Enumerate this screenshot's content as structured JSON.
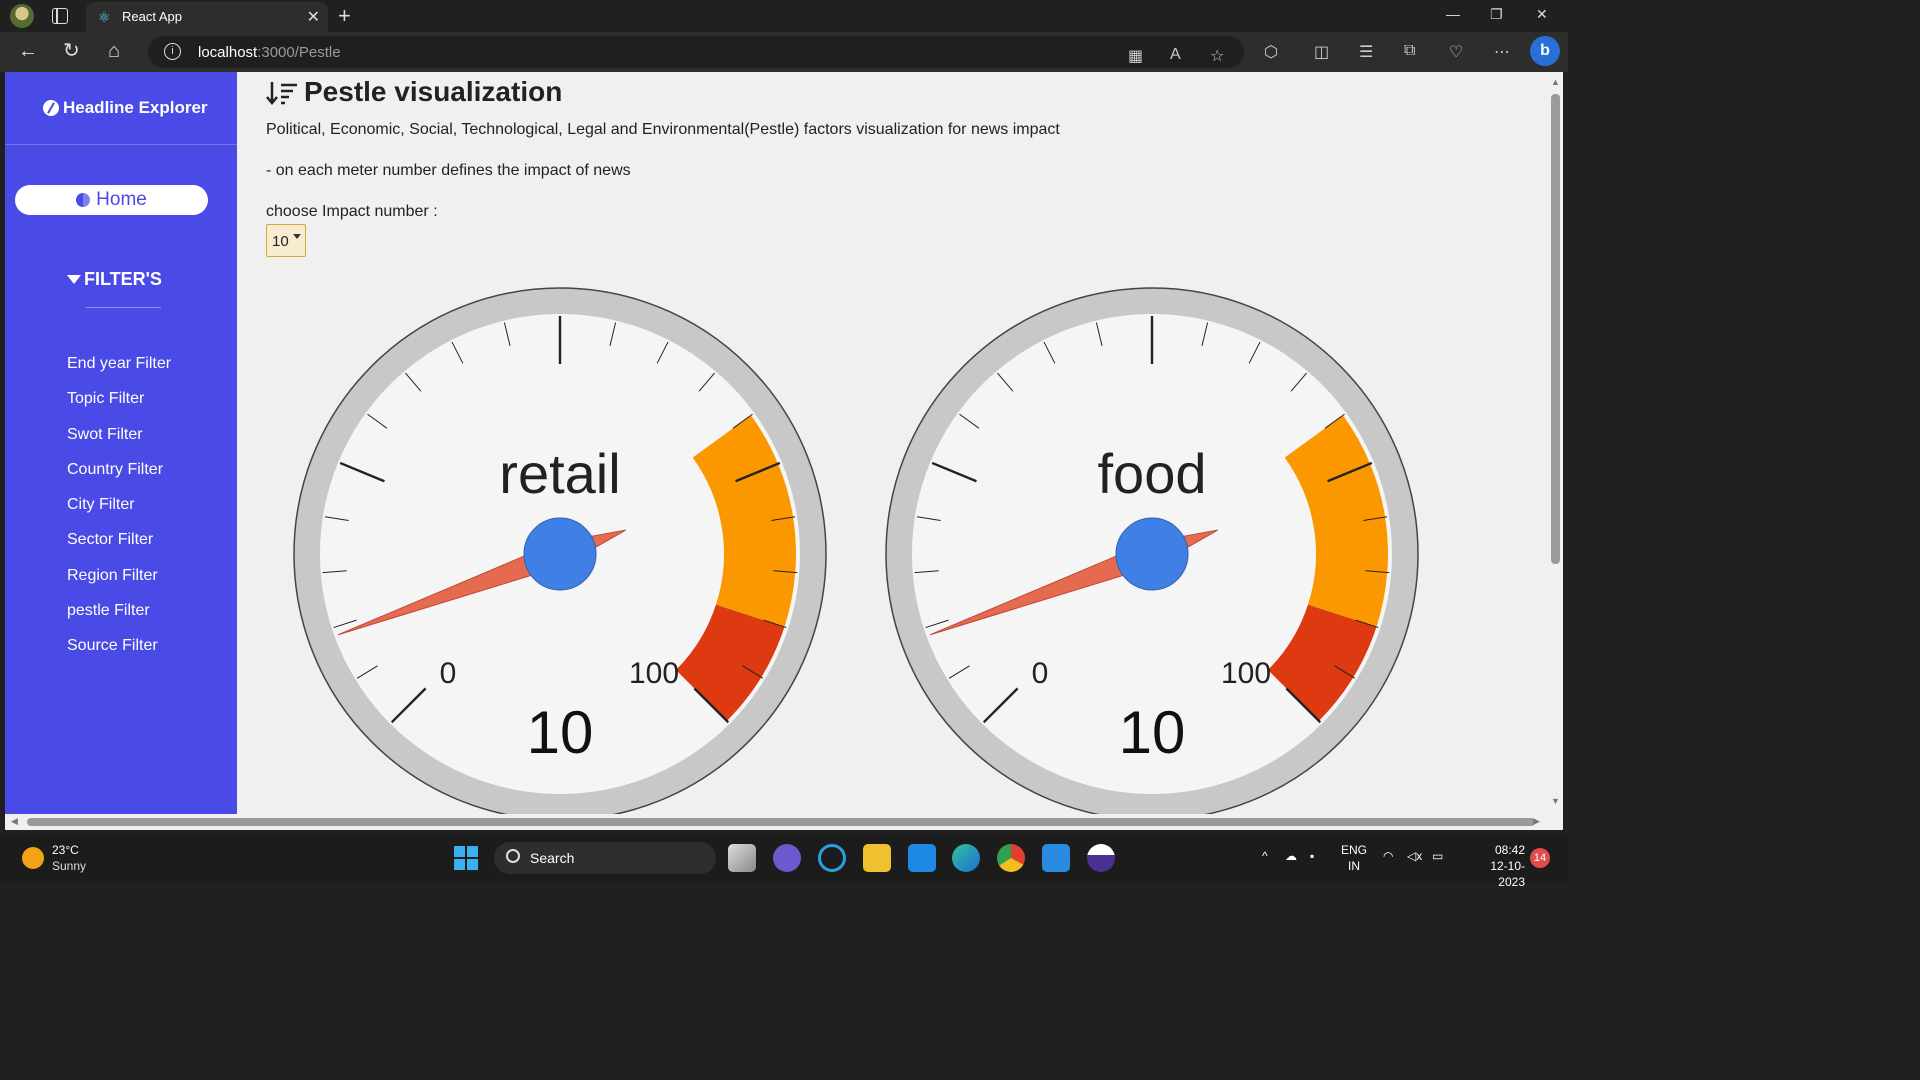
{
  "browser": {
    "tab_title": "React App",
    "url_host": "localhost",
    "url_rest": ":3000/Pestle"
  },
  "sidebar": {
    "brand": "Headline Explorer",
    "home_label": "Home",
    "filters_title": "FILTER'S",
    "items": [
      {
        "label": "End year Filter"
      },
      {
        "label": "Topic Filter"
      },
      {
        "label": "Swot Filter"
      },
      {
        "label": "Country Filter"
      },
      {
        "label": "City Filter"
      },
      {
        "label": "Sector Filter"
      },
      {
        "label": "Region Filter"
      },
      {
        "label": "pestle Filter"
      },
      {
        "label": "Source Filter"
      }
    ]
  },
  "main": {
    "title": "Pestle visualization",
    "description": "Political, Economic, Social, Technological, Legal and Environmental(Pestle) factors visualization for news impact",
    "note": "- on each meter number defines the impact of news",
    "select_label": "choose Impact number :",
    "select_value": "10"
  },
  "gauges": [
    {
      "label": "retail",
      "value": "10",
      "min_label": "0",
      "max_label": "100",
      "value_number": 10
    },
    {
      "label": "food",
      "value": "10",
      "min_label": "0",
      "max_label": "100",
      "value_number": 10
    }
  ],
  "colors": {
    "sidebar_bg": "#4a4ae6",
    "needle": "#e46a50",
    "hub": "#3f7fe6",
    "band_orange": "#fb9800",
    "band_red": "#dd3a12",
    "rim": "#c8c8c8"
  },
  "taskbar": {
    "temperature": "23°C",
    "weather": "Sunny",
    "search_label": "Search",
    "lang_line1": "ENG",
    "lang_line2": "IN",
    "time": "08:42",
    "date": "12-10-2023",
    "notifications": "14"
  }
}
